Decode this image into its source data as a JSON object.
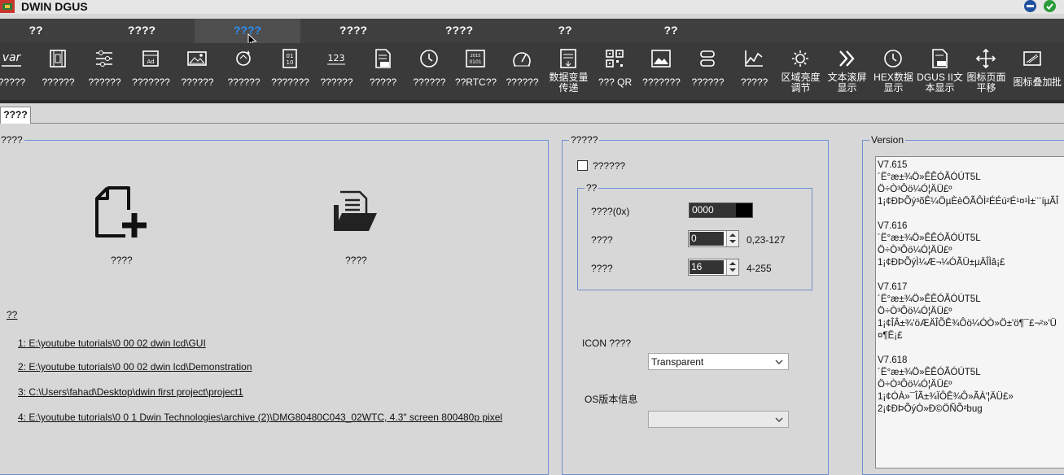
{
  "app": {
    "title": "DWIN DGUS"
  },
  "menu": {
    "tabs": [
      "??",
      "????",
      "????",
      "????",
      "????",
      "??",
      "??"
    ],
    "active_index": 2
  },
  "toolbar": {
    "items": [
      {
        "label": "?????",
        "icon": "var-icon"
      },
      {
        "label": "??????",
        "icon": "film-icon"
      },
      {
        "label": "??????",
        "icon": "sliders-icon"
      },
      {
        "label": "???????",
        "icon": "text-entry-icon"
      },
      {
        "label": "??????",
        "icon": "image-icon"
      },
      {
        "label": "??????",
        "icon": "rotate-icon"
      },
      {
        "label": "???????",
        "icon": "binary-icon"
      },
      {
        "label": "??????",
        "icon": "number-123-icon"
      },
      {
        "label": "?????",
        "icon": "text-file-icon"
      },
      {
        "label": "??????",
        "icon": "clock-icon"
      },
      {
        "label": "??RTC??",
        "icon": "rtc-icon"
      },
      {
        "label": "??????",
        "icon": "dial-icon"
      },
      {
        "label": "数据变量传递",
        "icon": "data-transfer-icon"
      },
      {
        "label": "??? QR",
        "icon": "qr-code-icon"
      },
      {
        "label": "???????",
        "icon": "picture-icon"
      },
      {
        "label": "??????",
        "icon": "scroll-icon"
      },
      {
        "label": "?????",
        "icon": "curve-icon"
      },
      {
        "label": "区域亮度调节",
        "icon": "brightness-icon"
      },
      {
        "label": "文本滚屏显示",
        "icon": "chevrons-icon"
      },
      {
        "label": "HEX数据显示",
        "icon": "hex-clock-icon"
      },
      {
        "label": "DGUS II文本显示",
        "icon": "text-display-icon"
      },
      {
        "label": "图标页面平移",
        "icon": "move-icon"
      },
      {
        "label": "图标叠加",
        "icon": "overlay-icon"
      },
      {
        "label": "批",
        "icon": ""
      }
    ]
  },
  "document_tab": "????",
  "left_panel": {
    "title": "????",
    "new_label": "????",
    "open_label": "????",
    "recent_header": "??",
    "recent": [
      "1:  E:\\youtube tutorials\\0 00 02 dwin lcd\\GUI",
      "2:  E:\\youtube tutorials\\0 00 02 dwin lcd\\Demonstration",
      "3:  C:\\Users\\fahad\\Desktop\\dwin first project\\project1",
      "4:  E:\\youtube tutorials\\0 0 1 Dwin Technologies\\archive (2)\\DMG80480C043_02WTC, 4.3\" screen 800480p pixel"
    ]
  },
  "mid_panel": {
    "title": "?????",
    "checkbox_label": "??????",
    "checkbox_checked": false,
    "inner_title": "??",
    "color_label": "????(0x)",
    "color_value": "0000",
    "field1_label": "????",
    "field1_value": "0",
    "field1_range": "0,23-127",
    "field2_label": "????",
    "field2_value": "16",
    "field2_range": "4-255",
    "icon_label": "ICON ????",
    "icon_select": "Transparent",
    "os_label": "OS版本信息",
    "os_select": ""
  },
  "version_panel": {
    "title": "Version",
    "text": "V7.615\n´Ë°æ±¾Ö»ÊÊÓÃÓÚT5L\nÖ÷Ò³Ôö¼Ó¦ÄÜ£º\n1¡¢ÐÞÕý³õÊ¼ÖµÈèÖÃÔÌ²ÉÉú²É¹¤¹Ì±¨¨íµÃÎ\n\nV7.616\n´Ë°æ±¾Ö»ÊÊÓÃÓÚT5L\nÖ÷Ò³Ôö¼Ó¦ÄÜ£º\n1¡¢ÐÞÕýÌ¼Æ¬¼ÓÃÜ±µÄÎÌâ¡£\n\nV7.617\n´Ë°æ±¾Ö»ÊÊÓÃÓÚT5L\nÖ÷Ò³Ôö¼Ó¦ÄÜ£º\n1¡¢ÎÂ±¾'öÆÄÎÕÊ¾Ôö¼ÓÒ»Ö±'ö¶¯£¬²»'Ü\n¤¶Ë¡£\n\nV7.618\n´Ë°æ±¾Ö»ÊÊÓÃÓÚT5L\nÖ÷Ò³Ôö¼Ó¦ÄÜ£º\n1¡¢ÓÀ»¯ÎÃ±¾ÏÔÊ¾Ô»ÃÀ'¦ÄÜ£»\n2¡¢ÐÞÕýÒ»Ð©ÖÑÕ²bug"
  },
  "colors": {
    "menu_bg": "#3f3f3f",
    "toolbar_bg": "#3a3a3a",
    "active_tab": "#2a8ef2",
    "panel_border": "#6f8fcf"
  }
}
